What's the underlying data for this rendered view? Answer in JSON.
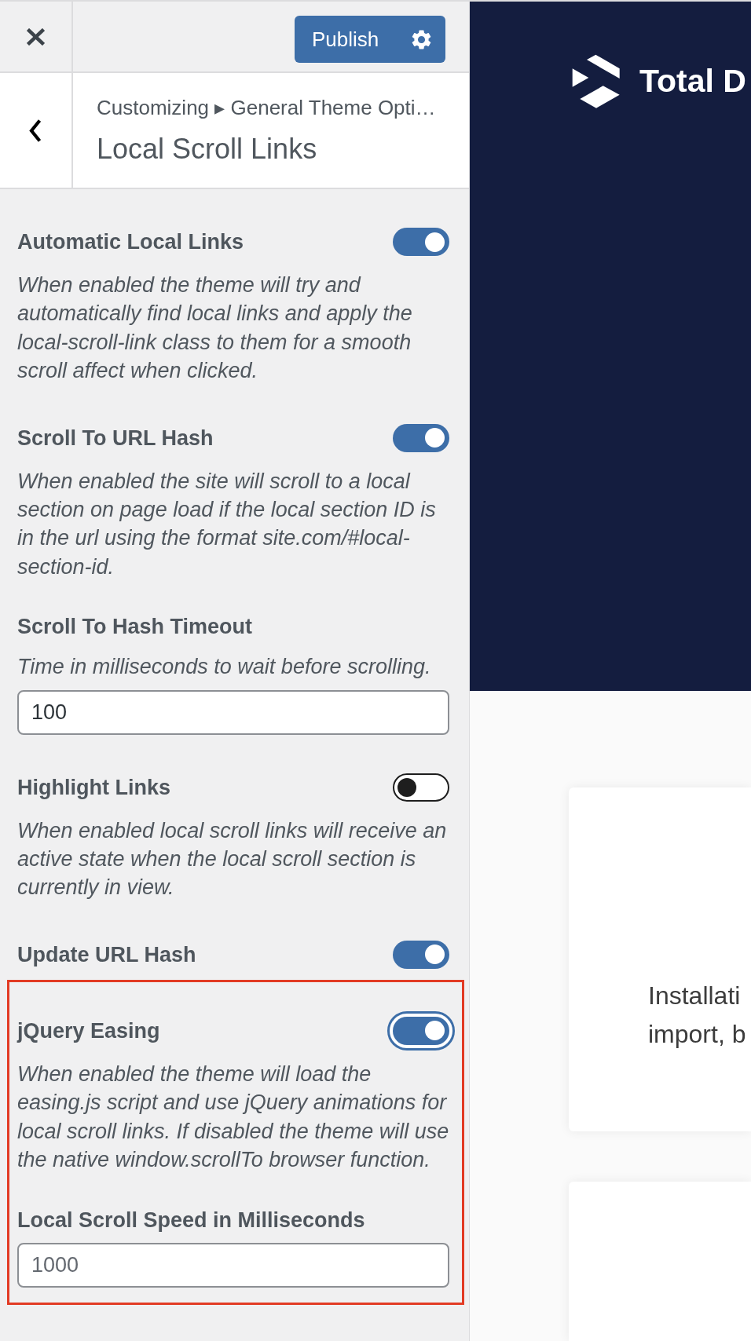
{
  "header": {
    "publish_label": "Publish"
  },
  "section": {
    "breadcrumb": "Customizing ▸ General Theme Opti…",
    "title": "Local Scroll Links"
  },
  "controls": [
    {
      "kind": "toggle",
      "label": "Automatic Local Links",
      "description": "When enabled the theme will try and automatically find local links and apply the local-scroll-link class to them for a smooth scroll affect when clicked.",
      "on": true,
      "focused": false,
      "highlighted": false
    },
    {
      "kind": "toggle",
      "label": "Scroll To URL Hash",
      "description": "When enabled the site will scroll to a local section on page load if the local section ID is in the url using the format site.com/#local-section-id.",
      "on": true,
      "focused": false,
      "highlighted": false
    },
    {
      "kind": "field",
      "label": "Scroll To Hash Timeout",
      "description": "Time in milliseconds to wait before scrolling.",
      "value": "100",
      "highlighted": false
    },
    {
      "kind": "toggle",
      "label": "Highlight Links",
      "description": "When enabled local scroll links will receive an active state when the local scroll section is currently in view.",
      "on": false,
      "focused": false,
      "highlighted": false
    },
    {
      "kind": "toggle",
      "label": "Update URL Hash",
      "on": true,
      "focused": false,
      "highlighted": false
    },
    {
      "kind": "toggle",
      "label": "jQuery Easing",
      "description": "When enabled the theme will load the easing.js script and use jQuery animations for local scroll links. If disabled the theme will use the native window.scrollTo browser function.",
      "on": true,
      "focused": true,
      "highlighted": true
    },
    {
      "kind": "field",
      "label": "Local Scroll Speed in Milliseconds",
      "placeholder": "1000",
      "highlighted": true
    }
  ],
  "preview": {
    "site_title": "Total D",
    "card_text": [
      "Installati",
      "import, b"
    ]
  }
}
